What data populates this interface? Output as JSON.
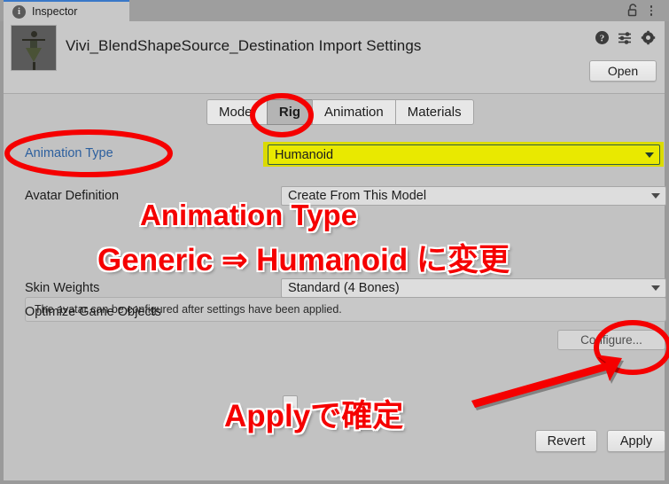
{
  "window": {
    "tab_label": "Inspector",
    "info_icon": "info-icon",
    "lock_icon": "lock-icon",
    "menu_icon": "kebab-menu-icon"
  },
  "header": {
    "asset_title": "Vivi_BlendShapeSource_Destination Import Settings",
    "thumbnail_alt": "model-thumbnail",
    "help_icon": "help-icon",
    "preset_icon": "preset-icon",
    "settings_icon": "gear-icon",
    "open_label": "Open"
  },
  "tabs": [
    {
      "label": "Model",
      "active": false
    },
    {
      "label": "Rig",
      "active": true
    },
    {
      "label": "Animation",
      "active": false
    },
    {
      "label": "Materials",
      "active": false
    }
  ],
  "properties": {
    "animation_type": {
      "label": "Animation Type",
      "value": "Humanoid",
      "highlight_color": "#e9e900",
      "highlight_border": "#2f5d44"
    },
    "avatar_definition": {
      "label": "Avatar Definition",
      "value": "Create From This Model"
    },
    "help_text": "The avatar can be configured after settings have been applied.",
    "configure_label": "Configure...",
    "skin_weights": {
      "label": "Skin Weights",
      "value": "Standard (4 Bones)"
    },
    "optimize_game_objects": {
      "label": "Optimize Game Objects",
      "checked": false
    }
  },
  "footer": {
    "revert_label": "Revert",
    "apply_label": "Apply"
  },
  "annotations": {
    "color": "#f50000",
    "line1": "Animation Type",
    "line2": "Generic ⇒ Humanoid に変更",
    "line3": "Applyで確定",
    "circles": [
      "animation-type-label",
      "rig-tab",
      "apply-button"
    ],
    "arrow": "arrow-to-apply-button"
  }
}
